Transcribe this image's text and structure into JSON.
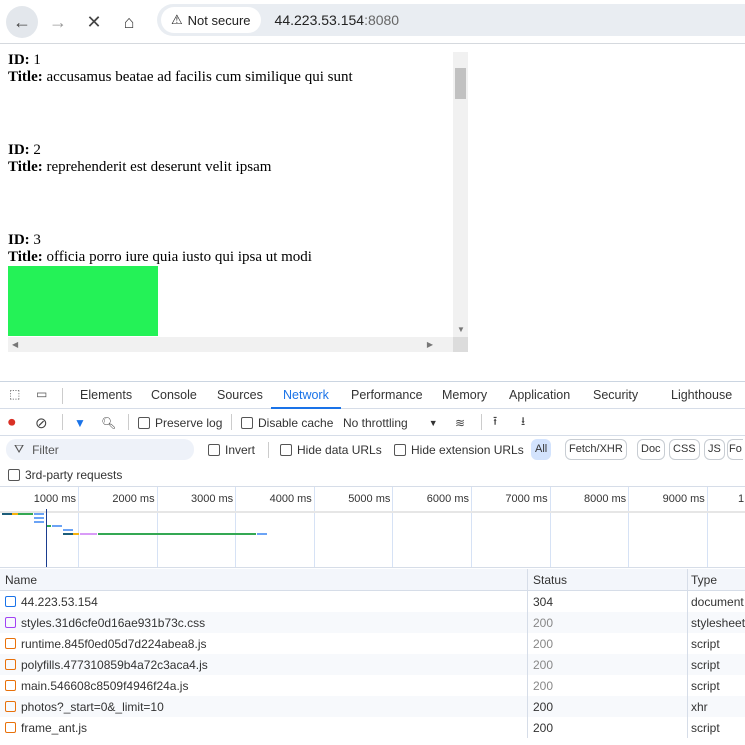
{
  "browser": {
    "security_label": "Not secure",
    "url_host": "44.223.53.154",
    "url_port": ":8080"
  },
  "page": {
    "id_label": "ID:",
    "title_label": "Title:",
    "items": [
      {
        "id": "1",
        "title": "accusamus beatae ad facilis cum similique qui sunt"
      },
      {
        "id": "2",
        "title": "reprehenderit est deserunt velit ipsam"
      },
      {
        "id": "3",
        "title": "officia porro iure quia iusto qui ipsa ut modi",
        "image_color": "#24f257"
      }
    ]
  },
  "devtools": {
    "tabs": [
      "Elements",
      "Console",
      "Sources",
      "Network",
      "Performance",
      "Memory",
      "Application",
      "Security",
      "Lighthouse"
    ],
    "active_tab": "Network",
    "toolbar": {
      "preserve_log": "Preserve log",
      "disable_cache": "Disable cache",
      "throttling": "No throttling"
    },
    "filter": {
      "placeholder": "Filter",
      "invert": "Invert",
      "hide_data": "Hide data URLs",
      "hide_ext": "Hide extension URLs",
      "chips": [
        "All",
        "Fetch/XHR",
        "Doc",
        "CSS",
        "JS",
        "Fo"
      ],
      "third_party": "3rd-party requests"
    },
    "timeline": {
      "ticks": [
        "1000 ms",
        "2000 ms",
        "3000 ms",
        "4000 ms",
        "5000 ms",
        "6000 ms",
        "7000 ms",
        "8000 ms",
        "9000 ms",
        "1"
      ]
    },
    "table": {
      "headers": {
        "name": "Name",
        "status": "Status",
        "type": "Type"
      },
      "rows": [
        {
          "name": "44.223.53.154",
          "status": "304",
          "type": "document",
          "icon": "document-icon",
          "color": "#1a73e8",
          "dim": false
        },
        {
          "name": "styles.31d6cfe0d16ae931b73c.css",
          "status": "200",
          "type": "stylesheet",
          "icon": "stylesheet-icon",
          "color": "#a142f4",
          "dim": true
        },
        {
          "name": "runtime.845f0ed05d7d224abea8.js",
          "status": "200",
          "type": "script",
          "icon": "script-icon",
          "color": "#e8710a",
          "dim": true
        },
        {
          "name": "polyfills.477310859b4a72c3aca4.js",
          "status": "200",
          "type": "script",
          "icon": "script-icon",
          "color": "#e8710a",
          "dim": true
        },
        {
          "name": "main.546608c8509f4946f24a.js",
          "status": "200",
          "type": "script",
          "icon": "script-icon",
          "color": "#e8710a",
          "dim": true
        },
        {
          "name": "photos?_start=0&_limit=10",
          "status": "200",
          "type": "xhr",
          "icon": "xhr-icon",
          "color": "#e8710a",
          "dim": false
        },
        {
          "name": "frame_ant.js",
          "status": "200",
          "type": "script",
          "icon": "script-icon",
          "color": "#e8710a",
          "dim": false
        }
      ]
    }
  }
}
